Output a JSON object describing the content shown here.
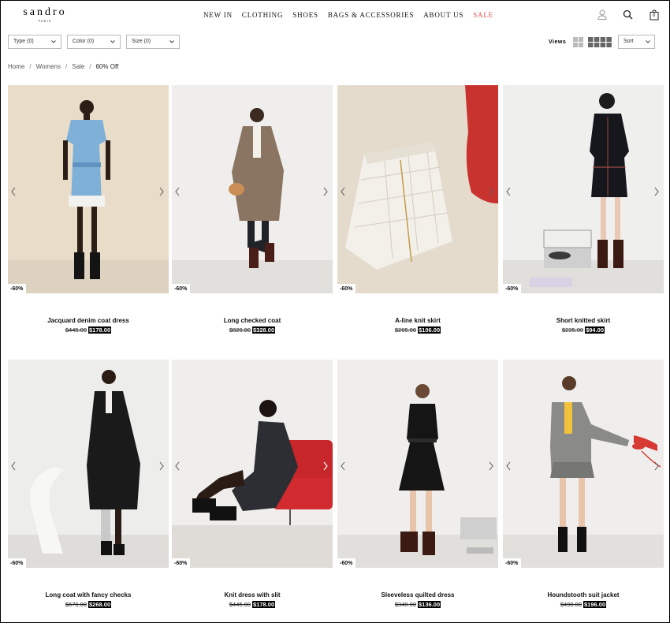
{
  "brand": {
    "name": "sandro",
    "sub": "PARIS"
  },
  "nav": [
    "NEW IN",
    "CLOTHING",
    "SHOES",
    "BAGS & ACCESSORIES",
    "ABOUT US",
    "SALE"
  ],
  "cart": {
    "count": "0"
  },
  "icons": [
    "account-icon",
    "search-icon",
    "cart-icon"
  ],
  "filters": [
    "Type (0)",
    "Color (0)",
    "Size (0)"
  ],
  "views": {
    "label": "Views",
    "options": [
      "2-column-grid-icon",
      "4-column-grid-icon"
    ]
  },
  "sort": {
    "label": "Sort"
  },
  "breadcrumb": [
    "Home",
    "Womens",
    "Sale",
    "60% Off"
  ],
  "products": [
    {
      "name": "Jacquard denim coat dress",
      "old_price": "$445.00",
      "new_price": "$178.00",
      "badge": "-60%"
    },
    {
      "name": "Long checked coat",
      "old_price": "$820.00",
      "new_price": "$328.00",
      "badge": "-60%"
    },
    {
      "name": "A-line knit skirt",
      "old_price": "$265.00",
      "new_price": "$106.00",
      "badge": "-60%"
    },
    {
      "name": "Short knitted skirt",
      "old_price": "$235.00",
      "new_price": "$94.00",
      "badge": "-60%"
    },
    {
      "name": "Long coat with fancy checks",
      "old_price": "$670.00",
      "new_price": "$268.00",
      "badge": "-60%"
    },
    {
      "name": "Knit dress with slit",
      "old_price": "$445.00",
      "new_price": "$178.00",
      "badge": "-60%"
    },
    {
      "name": "Sleeveless quilted dress",
      "old_price": "$340.00",
      "new_price": "$136.00",
      "badge": "-60%"
    },
    {
      "name": "Houndstooth suit jacket",
      "old_price": "$490.00",
      "new_price": "$196.00",
      "badge": "-60%"
    }
  ],
  "colors": {
    "sale_nav": "#e0504a",
    "price_bg": "#000000"
  }
}
